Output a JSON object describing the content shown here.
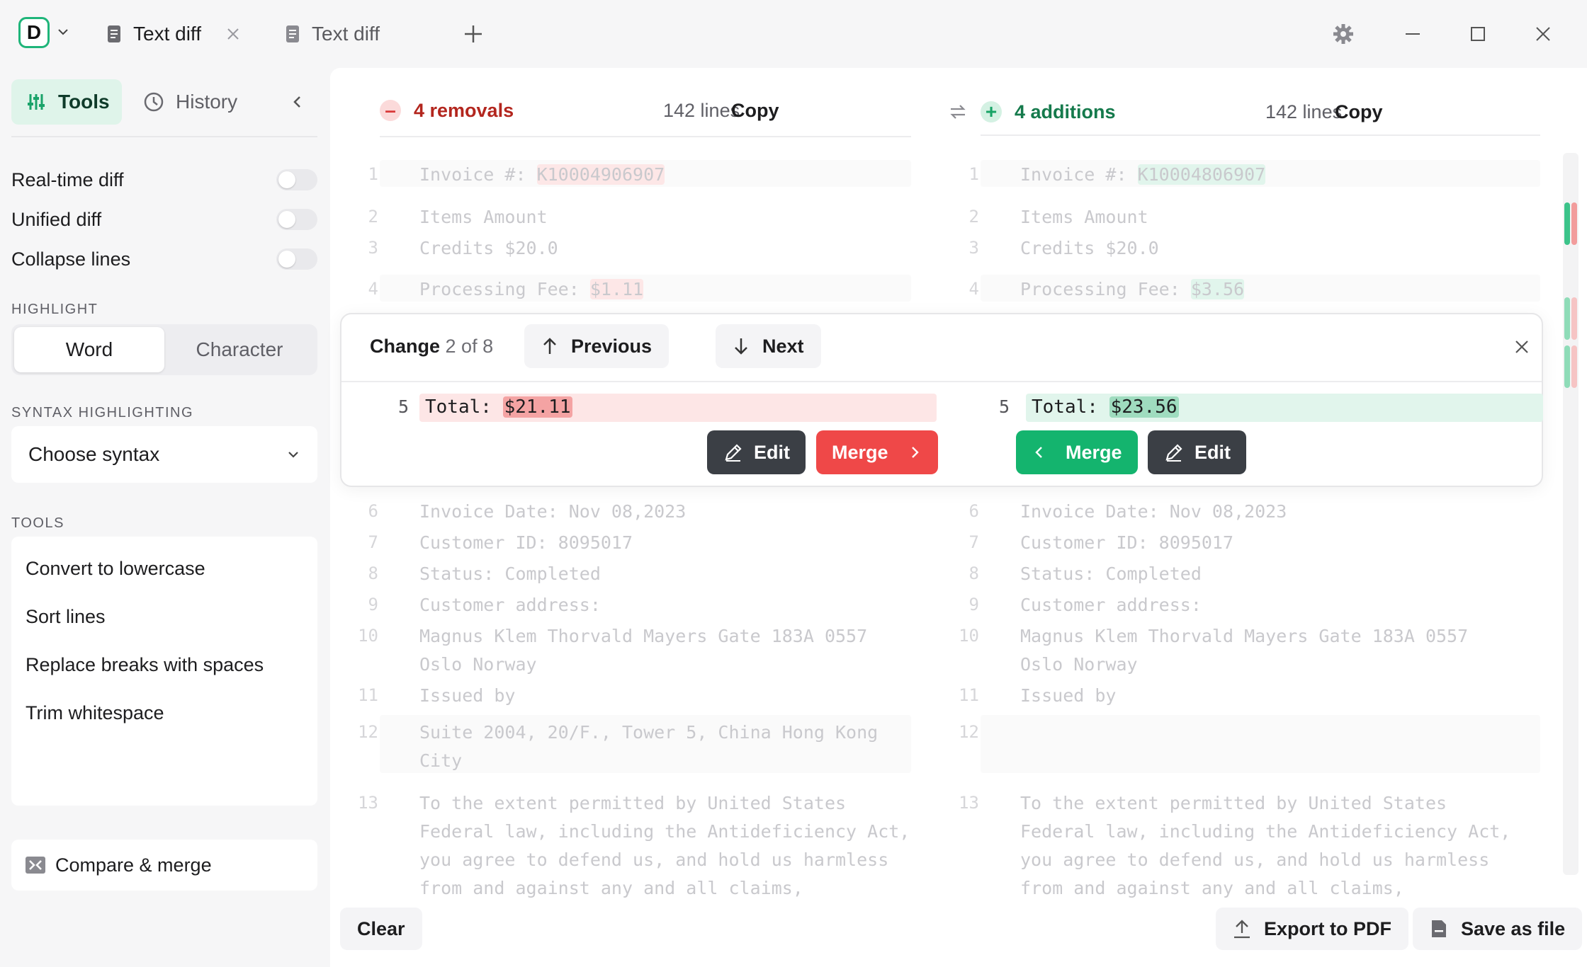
{
  "titlebar": {
    "logo_letter": "D",
    "tabs": [
      {
        "label": "Text diff",
        "active": true
      },
      {
        "label": "Text diff",
        "active": false
      }
    ]
  },
  "sidebar": {
    "tools_label": "Tools",
    "history_label": "History",
    "toggles": [
      {
        "label": "Real-time diff",
        "on": false
      },
      {
        "label": "Unified diff",
        "on": false
      },
      {
        "label": "Collapse lines",
        "on": false
      }
    ],
    "highlight_label": "HIGHLIGHT",
    "highlight_options": [
      "Word",
      "Character"
    ],
    "highlight_selected": "Word",
    "syntax_label": "SYNTAX HIGHLIGHTING",
    "syntax_value": "Choose syntax",
    "tools_section_label": "TOOLS",
    "tools_items": [
      "Convert to lowercase",
      "Sort lines",
      "Replace breaks with spaces",
      "Trim whitespace"
    ],
    "compare_label": "Compare & merge"
  },
  "left_pane": {
    "summary": "4 removals",
    "lines": "142 lines",
    "copy": "Copy"
  },
  "right_pane": {
    "summary": "4 additions",
    "lines": "142 lines",
    "copy": "Copy"
  },
  "left_code": [
    {
      "n": "1",
      "pre": "Invoice #: ",
      "hl": "K10004906907"
    },
    {
      "n": "2",
      "text": "Items Amount"
    },
    {
      "n": "3",
      "text": "Credits $20.0"
    },
    {
      "n": "4",
      "pre": "Processing Fee: ",
      "hl": "$1.11"
    },
    {
      "n": "6",
      "text": "Invoice Date: Nov 08,2023"
    },
    {
      "n": "7",
      "text": "Customer ID: 8095017"
    },
    {
      "n": "8",
      "text": "Status: Completed"
    },
    {
      "n": "9",
      "text": "Customer address:"
    },
    {
      "n": "10",
      "text": "Magnus Klem Thorvald Mayers Gate 183A 0557",
      "text2": "Oslo Norway"
    },
    {
      "n": "11",
      "text": "Issued by"
    },
    {
      "n": "12",
      "text": "Suite 2004, 20/F., Tower 5, China Hong Kong",
      "text2": "City"
    },
    {
      "n": "13",
      "text": "To the extent permitted by United States",
      "text2": "Federal law, including the Antideficiency Act,",
      "text3": "you agree to defend us, and hold us harmless",
      "text4": "from and against any and all claims,"
    }
  ],
  "right_code": [
    {
      "n": "1",
      "pre": "Invoice #: ",
      "hl": "K10004806907"
    },
    {
      "n": "2",
      "text": "Items Amount"
    },
    {
      "n": "3",
      "text": "Credits $20.0"
    },
    {
      "n": "4",
      "pre": "Processing Fee: ",
      "hl": "$3.56"
    },
    {
      "n": "6",
      "text": "Invoice Date: Nov 08,2023"
    },
    {
      "n": "7",
      "text": "Customer ID: 8095017"
    },
    {
      "n": "8",
      "text": "Status: Completed"
    },
    {
      "n": "9",
      "text": "Customer address:"
    },
    {
      "n": "10",
      "text": "Magnus Klem Thorvald Mayers Gate 183A 0557",
      "text2": "Oslo Norway"
    },
    {
      "n": "11",
      "text": "Issued by"
    },
    {
      "n": "12",
      "text": ""
    },
    {
      "n": "13",
      "text": "To the extent permitted by United States",
      "text2": "Federal law, including the Antideficiency Act,",
      "text3": "you agree to defend us, and hold us harmless",
      "text4": "from and against any and all claims,"
    }
  ],
  "change_popup": {
    "title_strong": "Change",
    "title_rest": "2 of 8",
    "previous": "Previous",
    "next": "Next",
    "left_line_num": "5",
    "left_pre": "Total: ",
    "left_hl": "$21.11",
    "right_line_num": "5",
    "right_pre": "Total: ",
    "right_hl": "$23.56",
    "edit": "Edit",
    "merge": "Merge"
  },
  "bottom": {
    "clear": "Clear",
    "export": "Export to PDF",
    "save": "Save as file"
  },
  "colors": {
    "accent_green": "#14b46e",
    "removal_red": "#ef4848",
    "dark_button": "#3b3f45"
  }
}
